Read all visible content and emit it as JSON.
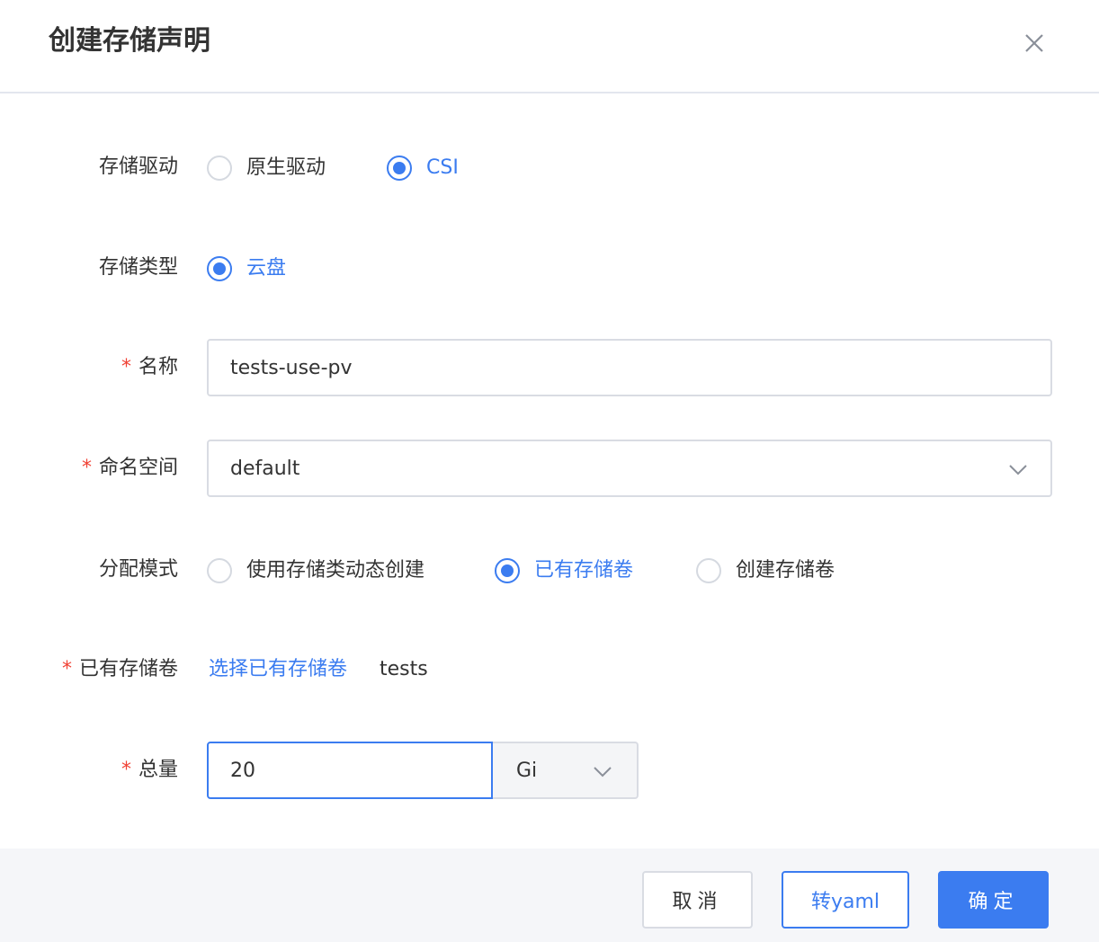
{
  "dialog": {
    "title": "创建存储声明",
    "close_icon": "close-icon"
  },
  "form": {
    "storage_driver": {
      "label": "存储驱动",
      "options": [
        {
          "label": "原生驱动",
          "checked": false
        },
        {
          "label": "CSI",
          "checked": true
        }
      ]
    },
    "storage_type": {
      "label": "存储类型",
      "options": [
        {
          "label": "云盘",
          "checked": true
        }
      ]
    },
    "name": {
      "required_mark": "*",
      "label": "名称",
      "value": "tests-use-pv"
    },
    "namespace": {
      "required_mark": "*",
      "label": "命名空间",
      "value": "default"
    },
    "allocation_mode": {
      "label": "分配模式",
      "options": [
        {
          "label": "使用存储类动态创建",
          "checked": false
        },
        {
          "label": "已有存储卷",
          "checked": true
        },
        {
          "label": "创建存储卷",
          "checked": false
        }
      ]
    },
    "existing_volume": {
      "required_mark": "*",
      "label": "已有存储卷",
      "select_link": "选择已有存储卷",
      "selected_value": "tests"
    },
    "capacity": {
      "required_mark": "*",
      "label": "总量",
      "value": "20",
      "unit": "Gi"
    }
  },
  "footer": {
    "cancel_label": "取消",
    "yaml_label": "转yaml",
    "ok_label": "确定"
  },
  "colors": {
    "accent": "#3b7cf0",
    "required": "#f04134",
    "footer_bg": "#f5f6f9"
  }
}
